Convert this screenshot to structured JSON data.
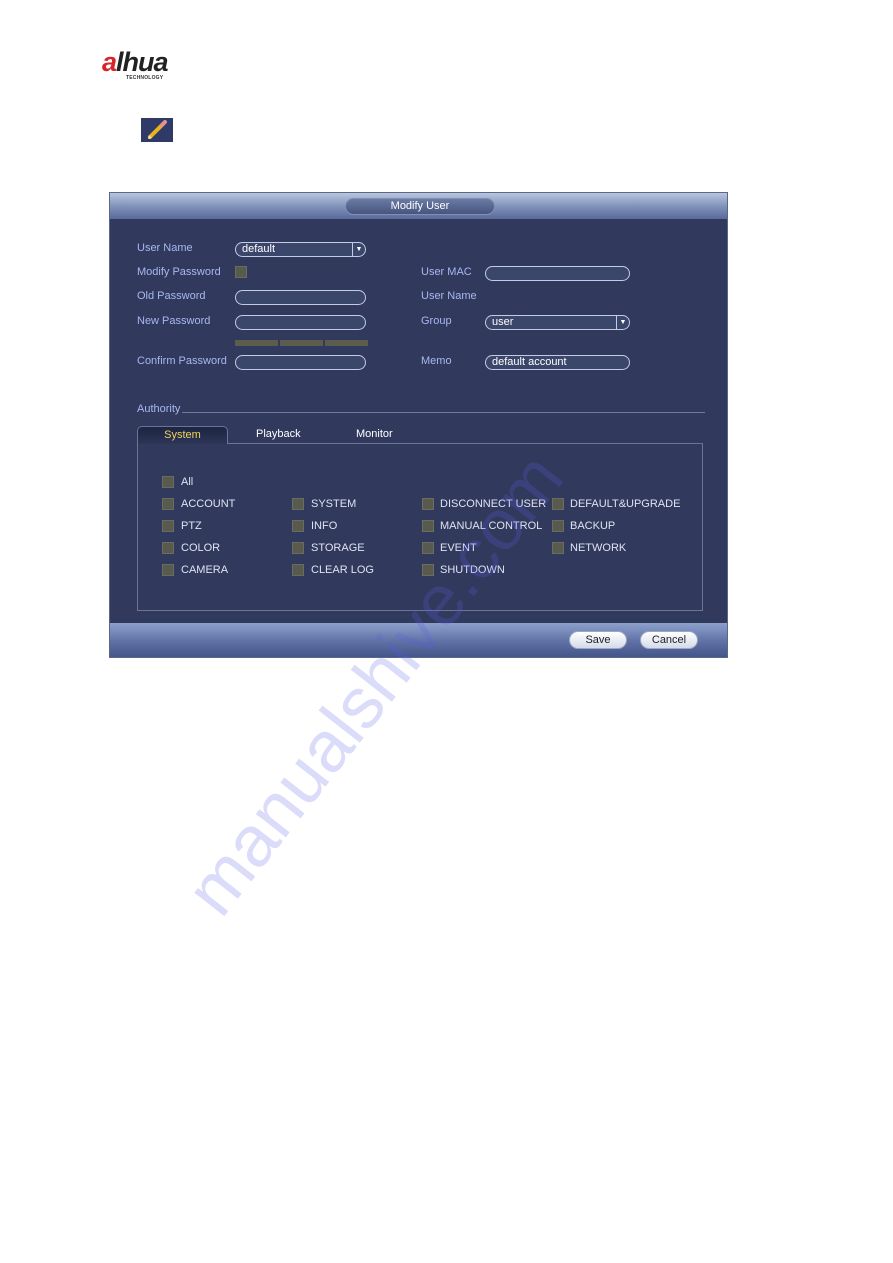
{
  "brand": {
    "name_accent": "a",
    "name_rest": "lhua",
    "tagline": "TECHNOLOGY"
  },
  "icons": {
    "edit": "pencil-icon",
    "dropdown": "chevron-down-icon"
  },
  "dialog": {
    "title": "Modify User",
    "left_form": {
      "user_name_label": "User Name",
      "user_name_value": "default",
      "modify_password_label": "Modify Password",
      "modify_password_checked": false,
      "old_password_label": "Old Password",
      "old_password_value": "",
      "new_password_label": "New Password",
      "new_password_value": "",
      "confirm_password_label": "Confirm Password",
      "confirm_password_value": ""
    },
    "right_form": {
      "user_mac_label": "User MAC",
      "user_mac_value": "",
      "user_name_label": "User Name",
      "group_label": "Group",
      "group_value": "user",
      "memo_label": "Memo",
      "memo_value": "default account"
    },
    "authority": {
      "label": "Authority",
      "tabs": [
        {
          "label": "System",
          "active": true
        },
        {
          "label": "Playback",
          "active": false
        },
        {
          "label": "Monitor",
          "active": false
        }
      ],
      "all_label": "All",
      "permissions": [
        [
          "ACCOUNT",
          "PTZ",
          "COLOR",
          "CAMERA"
        ],
        [
          "SYSTEM",
          "INFO",
          "STORAGE",
          "CLEAR LOG"
        ],
        [
          "DISCONNECT USER",
          "MANUAL CONTROL",
          "EVENT",
          "SHUTDOWN"
        ],
        [
          "DEFAULT&UPGRADE",
          "BACKUP",
          "NETWORK"
        ]
      ]
    },
    "buttons": {
      "save": "Save",
      "cancel": "Cancel"
    }
  },
  "watermark": "manualshive.com",
  "colors": {
    "dialog_bg": "#313a5d",
    "label": "#a9b7f0",
    "active_tab": "#f0d45a",
    "brand_red": "#d9232a"
  }
}
